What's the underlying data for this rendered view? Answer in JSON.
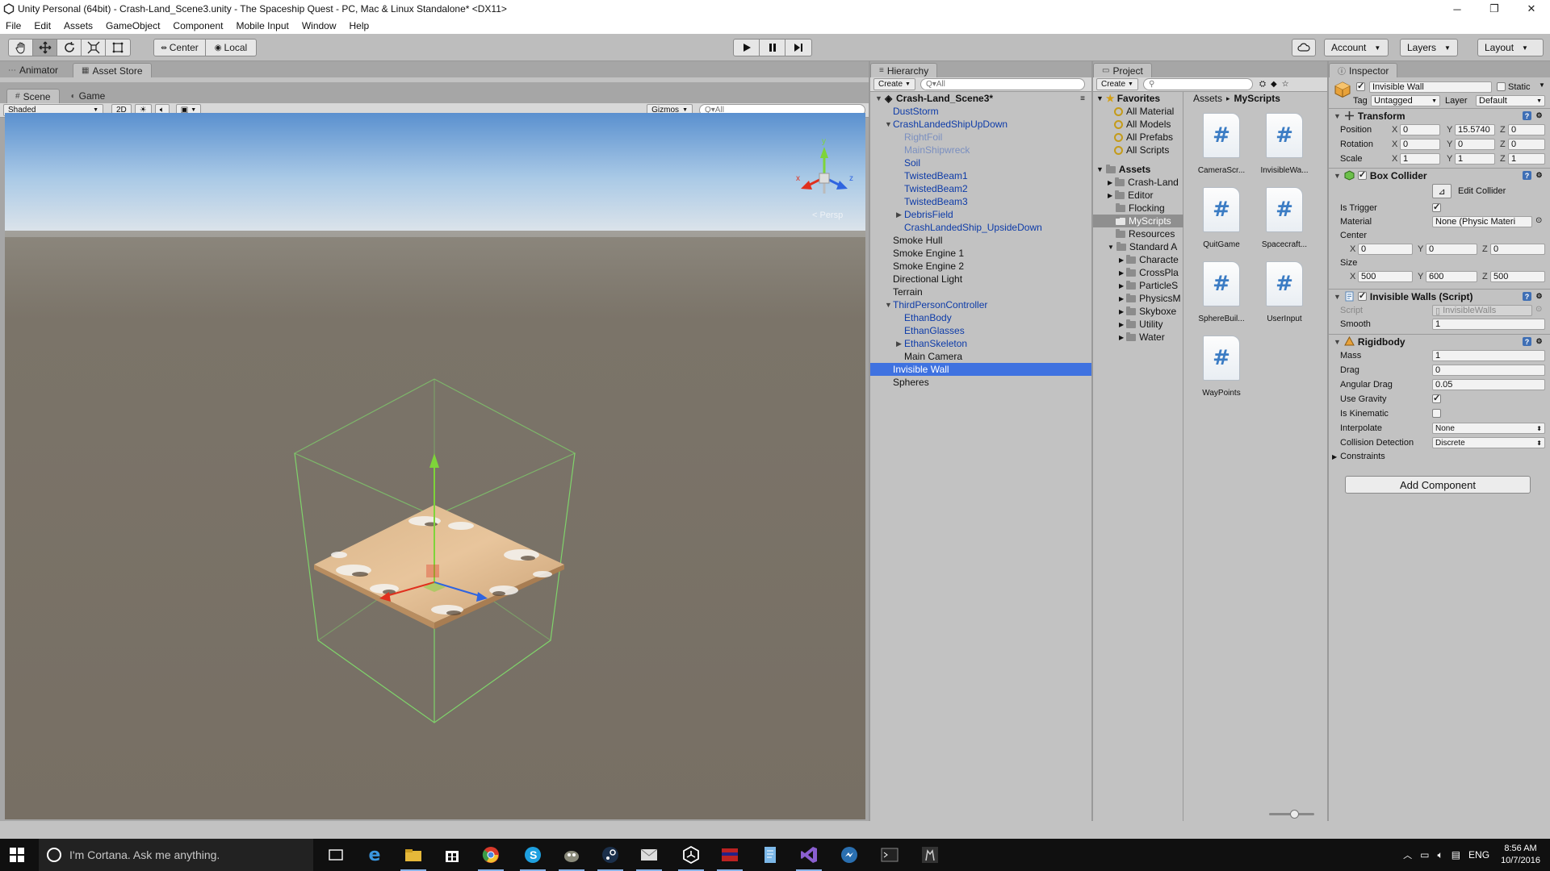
{
  "window": {
    "title": "Unity Personal (64bit) - Crash-Land_Scene3.unity - The Spaceship Quest - PC, Mac & Linux Standalone* <DX11>",
    "minimize": "─",
    "restore": "❐",
    "close": "✕"
  },
  "menu": [
    "File",
    "Edit",
    "Assets",
    "GameObject",
    "Component",
    "Mobile Input",
    "Window",
    "Help"
  ],
  "toolbar": {
    "pivot_center": "Center",
    "pivot_local": "Local",
    "account": "Account",
    "layers": "Layers",
    "layout": "Layout"
  },
  "top_tabs": {
    "animator": "Animator",
    "asset_store": "Asset Store"
  },
  "scene": {
    "tab_scene": "Scene",
    "tab_game": "Game",
    "shading_mode": "Shaded",
    "two_d": "2D",
    "gizmos": "Gizmos",
    "search_placeholder": "Q▾All",
    "persp_label": "< Persp",
    "gizmo_axes": [
      "y",
      "x",
      "z"
    ]
  },
  "hierarchy": {
    "tab": "Hierarchy",
    "create": "Create",
    "search_placeholder": "Q▾All",
    "scene_name": "Crash-Land_Scene3*",
    "items": [
      {
        "label": "DustStorm",
        "style": "prefab"
      },
      {
        "label": "CrashLandedShipUpDown",
        "style": "prefab",
        "expanded": true
      },
      {
        "label": "RightFoil",
        "style": "inactive"
      },
      {
        "label": "MainShipwreck",
        "style": "inactive"
      },
      {
        "label": "Soil",
        "style": "prefab"
      },
      {
        "label": "TwistedBeam1",
        "style": "prefab"
      },
      {
        "label": "TwistedBeam2",
        "style": "prefab"
      },
      {
        "label": "TwistedBeam3",
        "style": "prefab"
      },
      {
        "label": "DebrisField",
        "style": "prefab",
        "collapsed": true
      },
      {
        "label": "CrashLandedShip_UpsideDown",
        "style": "prefab"
      },
      {
        "label": "Smoke Hull",
        "style": "normal"
      },
      {
        "label": "Smoke Engine 1",
        "style": "normal"
      },
      {
        "label": "Smoke Engine 2",
        "style": "normal"
      },
      {
        "label": "Directional Light",
        "style": "normal"
      },
      {
        "label": "Terrain",
        "style": "normal"
      },
      {
        "label": "ThirdPersonController",
        "style": "prefab",
        "expanded": true
      },
      {
        "label": "EthanBody",
        "style": "prefab"
      },
      {
        "label": "EthanGlasses",
        "style": "prefab"
      },
      {
        "label": "EthanSkeleton",
        "style": "prefab",
        "collapsed": true
      },
      {
        "label": "Main Camera",
        "style": "normal"
      },
      {
        "label": "Invisible Wall",
        "style": "selected"
      },
      {
        "label": "Spheres",
        "style": "normal"
      }
    ]
  },
  "project": {
    "tab": "Project",
    "create": "Create",
    "favorites_label": "Favorites",
    "favorites": [
      "All Material",
      "All Models",
      "All Prefabs",
      "All Scripts"
    ],
    "assets_label": "Assets",
    "folders": [
      "Crash-Land",
      "Editor",
      "Flocking",
      "MyScripts",
      "Resources",
      "Standard A"
    ],
    "standard_subfolders": [
      "Characte",
      "CrossPla",
      "ParticleS",
      "PhysicsM",
      "Skyboxe",
      "Utility",
      "Water"
    ],
    "breadcrumb_root": "Assets",
    "breadcrumb_sep": "▸",
    "breadcrumb_current": "MyScripts",
    "files": [
      "CameraScr...",
      "InvisibleWa...",
      "QuitGame",
      "Spacecraft...",
      "SphereBuil...",
      "UserInput",
      "WayPoints"
    ]
  },
  "inspector": {
    "tab": "Inspector",
    "object_name": "Invisible Wall",
    "static_label": "Static",
    "tag_label": "Tag",
    "tag_value": "Untagged",
    "layer_label": "Layer",
    "layer_value": "Default",
    "transform": {
      "title": "Transform",
      "position_label": "Position",
      "position": {
        "x": "0",
        "y": "15.5740",
        "z": "0"
      },
      "rotation_label": "Rotation",
      "rotation": {
        "x": "0",
        "y": "0",
        "z": "0"
      },
      "scale_label": "Scale",
      "scale": {
        "x": "1",
        "y": "1",
        "z": "1"
      }
    },
    "box_collider": {
      "title": "Box Collider",
      "edit_collider": "Edit Collider",
      "is_trigger_label": "Is Trigger",
      "is_trigger": true,
      "material_label": "Material",
      "material_value": "None (Physic Materi",
      "center_label": "Center",
      "center": {
        "x": "0",
        "y": "0",
        "z": "0"
      },
      "size_label": "Size",
      "size": {
        "x": "500",
        "y": "600",
        "z": "500"
      }
    },
    "script_comp": {
      "title": "Invisible Walls (Script)",
      "script_label": "Script",
      "script_value": "InvisibleWalls",
      "smooth_label": "Smooth",
      "smooth_value": "1"
    },
    "rigidbody": {
      "title": "Rigidbody",
      "mass_label": "Mass",
      "mass": "1",
      "drag_label": "Drag",
      "drag": "0",
      "angular_drag_label": "Angular Drag",
      "angular_drag": "0.05",
      "use_gravity_label": "Use Gravity",
      "use_gravity": true,
      "is_kinematic_label": "Is Kinematic",
      "is_kinematic": false,
      "interpolate_label": "Interpolate",
      "interpolate": "None",
      "collision_label": "Collision Detection",
      "collision": "Discrete",
      "constraints_label": "Constraints"
    },
    "add_component": "Add Component",
    "axis_x": "X",
    "axis_y": "Y",
    "axis_z": "Z"
  },
  "taskbar": {
    "cortana_placeholder": "I'm Cortana. Ask me anything.",
    "lang": "ENG",
    "time": "8:56 AM",
    "date": "10/7/2016"
  },
  "colors": {
    "selection": "#3f72e0",
    "prefab_text": "#0d3ba8",
    "collider_wire": "#7fd36b"
  }
}
